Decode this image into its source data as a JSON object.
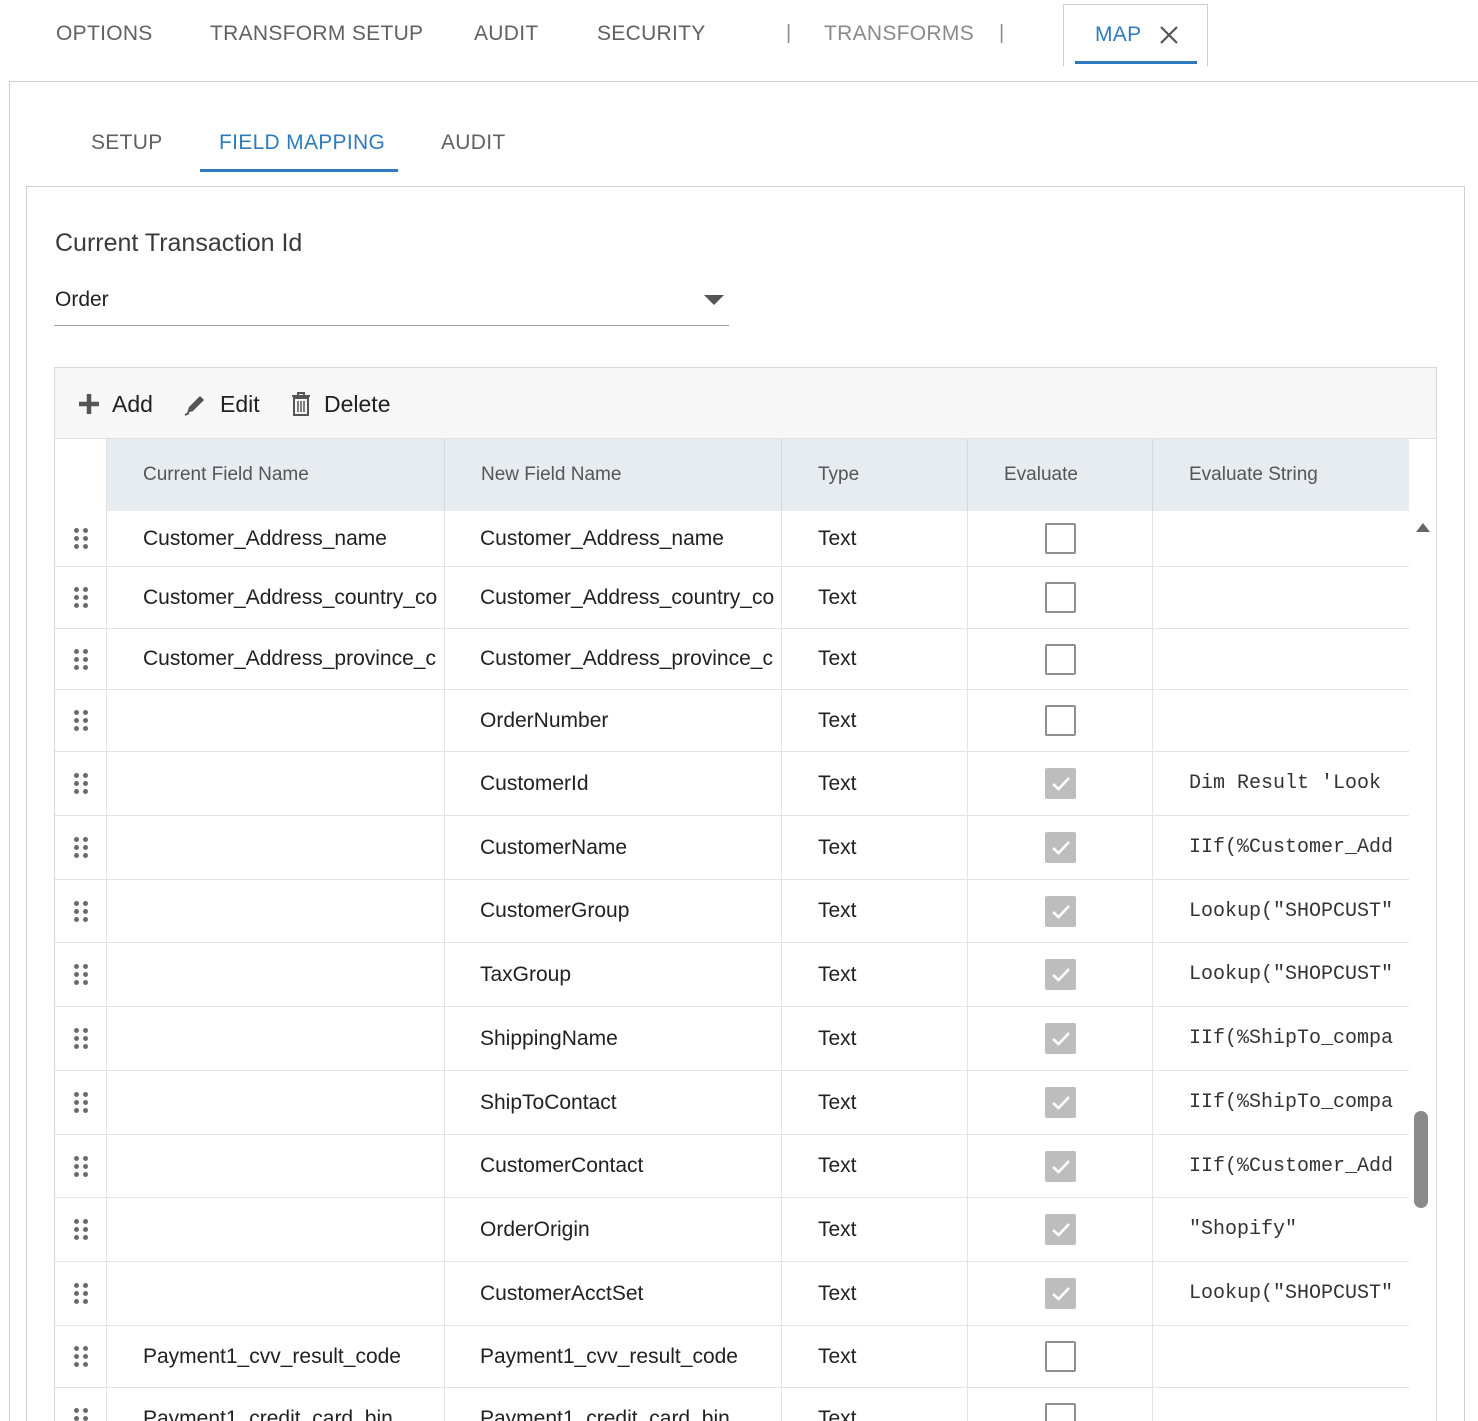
{
  "top_tabs": {
    "options": "OPTIONS",
    "transform_setup": "TRANSFORM SETUP",
    "audit": "AUDIT",
    "security": "SECURITY",
    "separator": "|",
    "transforms": "TRANSFORMS",
    "map": "MAP"
  },
  "sub_tabs": {
    "setup": "SETUP",
    "field_mapping": "FIELD MAPPING",
    "audit": "AUDIT",
    "active": "FIELD MAPPING"
  },
  "transaction": {
    "title": "Current Transaction Id",
    "selected": "Order"
  },
  "toolbar": {
    "add": "Add",
    "edit": "Edit",
    "delete": "Delete"
  },
  "columns": {
    "current_field_name": "Current Field Name",
    "new_field_name": "New Field Name",
    "type": "Type",
    "evaluate": "Evaluate",
    "evaluate_string": "Evaluate String"
  },
  "rows": [
    {
      "current": "Customer_Address_name",
      "new": "Customer_Address_name",
      "type": "Text",
      "evaluate": false,
      "eval_string": ""
    },
    {
      "current": "Customer_Address_country_co",
      "new": "Customer_Address_country_co",
      "type": "Text",
      "evaluate": false,
      "eval_string": ""
    },
    {
      "current": "Customer_Address_province_c",
      "new": "Customer_Address_province_c",
      "type": "Text",
      "evaluate": false,
      "eval_string": ""
    },
    {
      "current": "",
      "new": "OrderNumber",
      "type": "Text",
      "evaluate": false,
      "eval_string": ""
    },
    {
      "current": "",
      "new": "CustomerId",
      "type": "Text",
      "evaluate": true,
      "eval_string": "Dim Result 'Look"
    },
    {
      "current": "",
      "new": "CustomerName",
      "type": "Text",
      "evaluate": true,
      "eval_string": "IIf(%Customer_Add"
    },
    {
      "current": "",
      "new": "CustomerGroup",
      "type": "Text",
      "evaluate": true,
      "eval_string": "Lookup(\"SHOPCUST\""
    },
    {
      "current": "",
      "new": "TaxGroup",
      "type": "Text",
      "evaluate": true,
      "eval_string": "Lookup(\"SHOPCUST\""
    },
    {
      "current": "",
      "new": "ShippingName",
      "type": "Text",
      "evaluate": true,
      "eval_string": "IIf(%ShipTo_compa"
    },
    {
      "current": "",
      "new": "ShipToContact",
      "type": "Text",
      "evaluate": true,
      "eval_string": "IIf(%ShipTo_compa"
    },
    {
      "current": "",
      "new": "CustomerContact",
      "type": "Text",
      "evaluate": true,
      "eval_string": "IIf(%Customer_Add"
    },
    {
      "current": "",
      "new": "OrderOrigin",
      "type": "Text",
      "evaluate": true,
      "eval_string": "\"Shopify\""
    },
    {
      "current": "",
      "new": "CustomerAcctSet",
      "type": "Text",
      "evaluate": true,
      "eval_string": "Lookup(\"SHOPCUST\""
    },
    {
      "current": "Payment1_cvv_result_code",
      "new": "Payment1_cvv_result_code",
      "type": "Text",
      "evaluate": false,
      "eval_string": ""
    },
    {
      "current": "Payment1_credit_card_bin",
      "new": "Payment1_credit_card_bin",
      "type": "Text",
      "evaluate": false,
      "eval_string": ""
    }
  ],
  "colors": {
    "accent": "#2f7bbd",
    "header_bg": "#e6ecf0",
    "checked_bg": "#bdbdbd"
  }
}
